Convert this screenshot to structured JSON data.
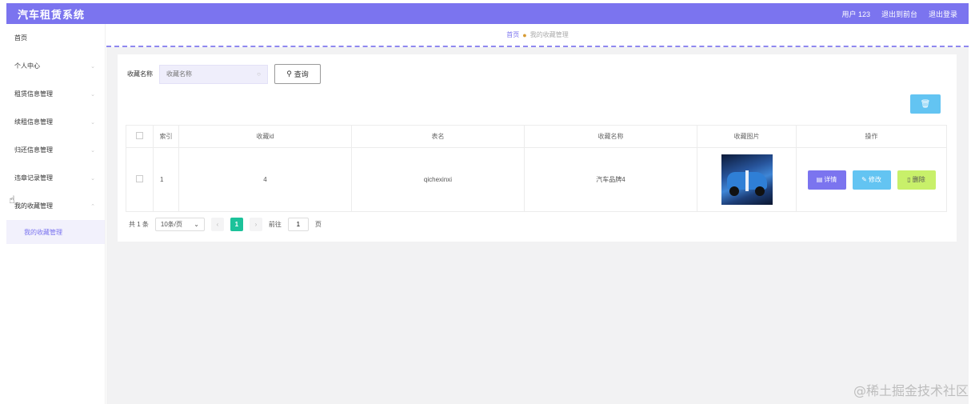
{
  "header": {
    "title": "汽车租赁系统",
    "user": "用户 123",
    "to_frontend": "退出到前台",
    "logout": "退出登录"
  },
  "sidebar": {
    "items": [
      {
        "label": "首页",
        "has_arrow": false
      },
      {
        "label": "个人中心",
        "has_arrow": true
      },
      {
        "label": "租赁信息管理",
        "has_arrow": true
      },
      {
        "label": "续租信息管理",
        "has_arrow": true
      },
      {
        "label": "归还信息管理",
        "has_arrow": true
      },
      {
        "label": "违章记录管理",
        "has_arrow": true
      },
      {
        "label": "我的收藏管理",
        "has_arrow": true
      }
    ],
    "subitem": "我的收藏管理"
  },
  "breadcrumb": {
    "home": "首页",
    "current": "我的收藏管理"
  },
  "search": {
    "label": "收藏名称",
    "placeholder": "收藏名称",
    "button": "查询"
  },
  "table": {
    "headers": [
      "",
      "索引",
      "收藏id",
      "表名",
      "收藏名称",
      "收藏图片",
      "操作"
    ],
    "rows": [
      {
        "index": "1",
        "id": "4",
        "table": "qichexinxi",
        "name": "汽车品牌4"
      }
    ],
    "actions": {
      "detail": "详情",
      "edit": "修改",
      "delete": "删除"
    }
  },
  "pagination": {
    "total": "共 1 条",
    "page_size": "10条/页",
    "current": "1",
    "goto_label": "前往",
    "goto_value": "1",
    "page_unit": "页"
  },
  "watermark": "@稀土掘金技术社区",
  "colors": {
    "accent": "#7b74ef",
    "info": "#63c4f2",
    "success": "#1cc29a",
    "lime": "#c8f06a"
  }
}
